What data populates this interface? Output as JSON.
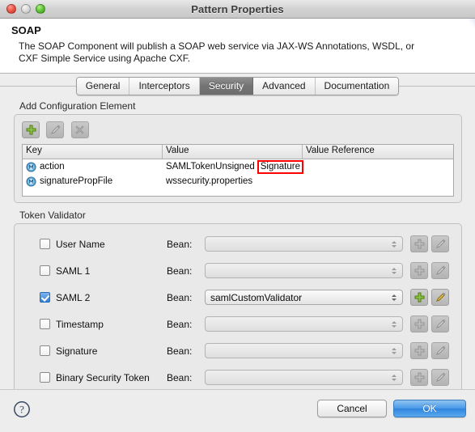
{
  "window": {
    "title": "Pattern Properties",
    "controls": {
      "close": "close-button",
      "minimize": "minimize-button",
      "zoom": "zoom-button"
    }
  },
  "header": {
    "title": "SOAP",
    "description": "The SOAP Component will publish a SOAP web service via JAX-WS Annotations, WSDL, or CXF Simple Service using Apache CXF."
  },
  "tabs": [
    {
      "label": "General",
      "selected": false
    },
    {
      "label": "Interceptors",
      "selected": false
    },
    {
      "label": "Security",
      "selected": true
    },
    {
      "label": "Advanced",
      "selected": false
    },
    {
      "label": "Documentation",
      "selected": false
    }
  ],
  "config_section": {
    "label": "Add Configuration Element",
    "toolbar": [
      {
        "name": "add-element-button",
        "icon": "plus-icon",
        "enabled": true
      },
      {
        "name": "edit-element-button",
        "icon": "pencil-icon",
        "enabled": false
      },
      {
        "name": "delete-element-button",
        "icon": "delete-icon",
        "enabled": false
      }
    ],
    "table": {
      "columns": [
        "Key",
        "Value",
        "Value Reference"
      ],
      "rows": [
        {
          "icon": "property-icon",
          "key": "action",
          "value": "SAMLTokenUnsigned",
          "value_highlight": "Signature",
          "highlight_color": "#ff0000",
          "value_reference": ""
        },
        {
          "icon": "property-icon",
          "key": "signaturePropFile",
          "value": "wssecurity.properties",
          "value_highlight": "",
          "value_reference": ""
        }
      ]
    }
  },
  "token_validator": {
    "label": "Token Validator",
    "bean_label": "Bean:",
    "rows": [
      {
        "label": "User Name",
        "checked": false,
        "bean": "",
        "buttons_enabled": false
      },
      {
        "label": "SAML 1",
        "checked": false,
        "bean": "",
        "buttons_enabled": false
      },
      {
        "label": "SAML 2",
        "checked": true,
        "bean": "samlCustomValidator",
        "buttons_enabled": true
      },
      {
        "label": "Timestamp",
        "checked": false,
        "bean": "",
        "buttons_enabled": false
      },
      {
        "label": "Signature",
        "checked": false,
        "bean": "",
        "buttons_enabled": false
      },
      {
        "label": "Binary Security Token",
        "checked": false,
        "bean": "",
        "buttons_enabled": false
      }
    ]
  },
  "footer": {
    "help_icon": "help-icon",
    "cancel_label": "Cancel",
    "ok_label": "OK",
    "ok_accent": "#2f84dd"
  }
}
